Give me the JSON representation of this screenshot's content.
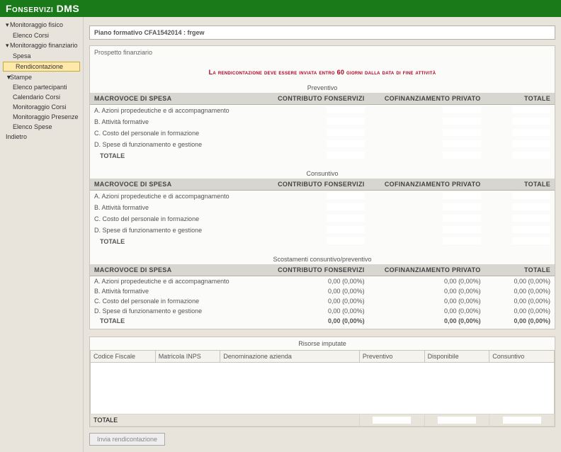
{
  "app_title": "Fonservizi DMS",
  "sidebar": {
    "items": [
      {
        "label": "Monitoraggio fisico",
        "caret": "▾"
      },
      {
        "label": "Elenco Corsi",
        "sub": true
      },
      {
        "label": "Monitoraggio finanziario",
        "caret": "▾"
      },
      {
        "label": "Spesa",
        "sub": true
      },
      {
        "label": "Rendicontazione",
        "sub": true,
        "selected": true
      },
      {
        "label": "Stampe",
        "caret": "▼"
      },
      {
        "label": "Elenco partecipanti",
        "sub": true
      },
      {
        "label": "Calendario Corsi",
        "sub": true
      },
      {
        "label": "Monitoraggio Corsi",
        "sub": true
      },
      {
        "label": "Monitoraggio Presenze",
        "sub": true
      },
      {
        "label": "Elenco Spese",
        "sub": true
      },
      {
        "label": "Indietro"
      }
    ]
  },
  "plan_bar": "Piano formativo CFA1542014 : frgew",
  "panel_title": "Prospetto finanziario",
  "alert_text": "La rendicontazione deve essere inviata entro 60 giorni dalla data di fine attività",
  "columns": {
    "macro": "MACROVOCE DI SPESA",
    "contrib": "CONTRIBUTO FONSERVIZI",
    "cofin": "COFINANZIAMENTO PRIVATO",
    "totale": "TOTALE"
  },
  "rows": [
    "A. Azioni propedeutiche e di accompagnamento",
    "B. Attività formative",
    "C. Costo del personale in formazione",
    "D. Spese di funzionamento e gestione",
    "TOTALE"
  ],
  "sections": {
    "preventivo": "Preventivo",
    "consuntivo": "Consuntivo",
    "scost": "Scostamenti consuntivo/preventivo"
  },
  "scost_value": "0,00 (0,00%)",
  "risorse": {
    "title": "Risorse imputate",
    "heads": [
      "Codice Fiscale",
      "Matricola INPS",
      "Denominazione azienda",
      "Preventivo",
      "Disponibile",
      "Consuntivo"
    ],
    "totale": "TOTALE"
  },
  "submit_label": "Invia rendicontazione"
}
